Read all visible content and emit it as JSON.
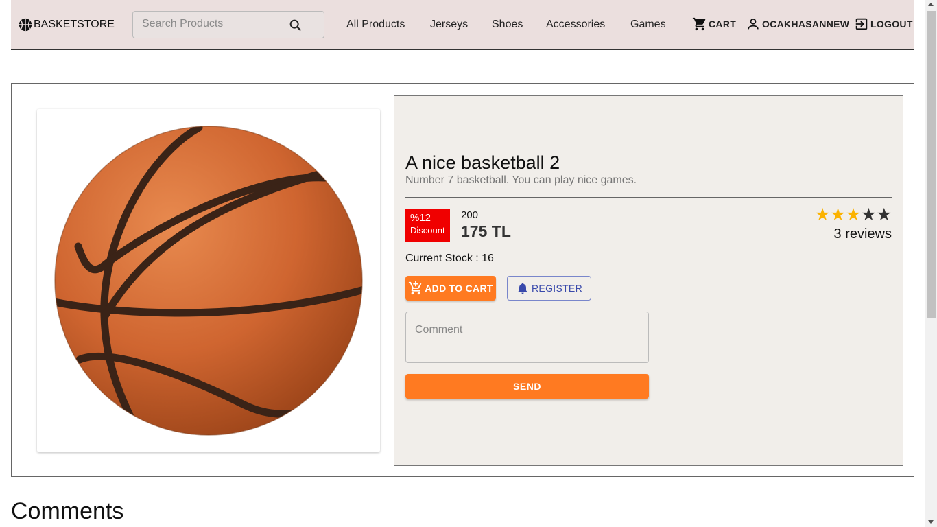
{
  "header": {
    "brand": "BASKETSTORE",
    "search_placeholder": "Search Products",
    "nav": [
      "All Products",
      "Jerseys",
      "Shoes",
      "Accessories",
      "Games"
    ],
    "cart_label": "CART",
    "user_label": "OCAKHASANNEW",
    "logout_label": "LOGOUT"
  },
  "product": {
    "title": "A nice basketball 2",
    "description": "Number 7 basketball. You can play nice games.",
    "discount_percent": "%12",
    "discount_label": "Discount",
    "old_price": "200",
    "new_price": "175 TL",
    "rating": 3,
    "rating_max": 5,
    "reviews": "3 reviews",
    "stock_text": "Current Stock : 16",
    "add_to_cart_label": "ADD TO CART",
    "register_label": "REGISTER",
    "comment_placeholder": "Comment",
    "send_label": "SEND"
  },
  "comments_section": {
    "heading": "Comments"
  },
  "colors": {
    "navbar_bg": "#ebdfde",
    "accent_orange": "#ff7a21",
    "discount_red": "#f00000",
    "star_gold": "#fbb200",
    "register_blue": "#3949ab"
  }
}
